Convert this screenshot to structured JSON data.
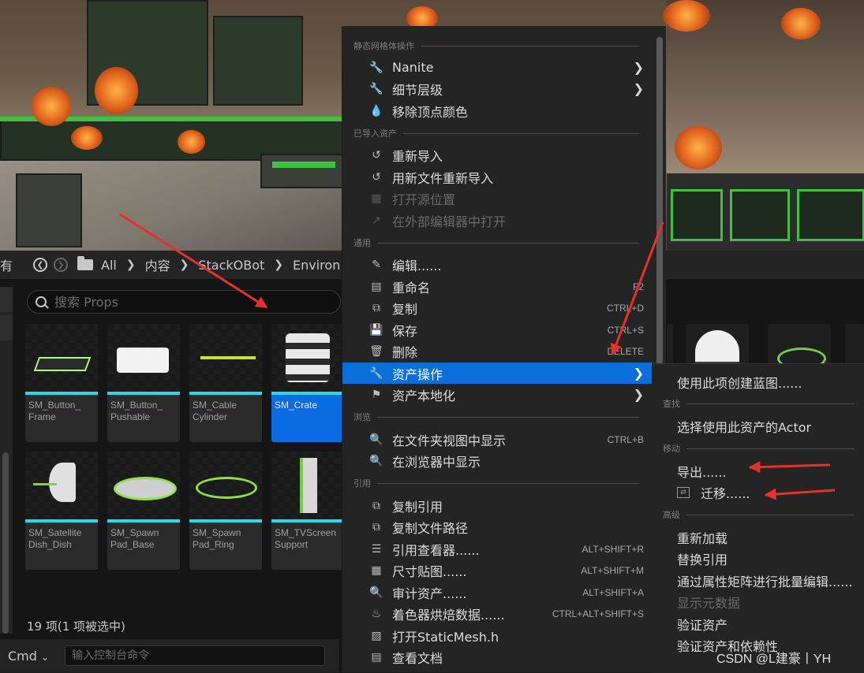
{
  "breadcrumb": {
    "leading": "有",
    "items": [
      "All",
      "内容",
      "StackOBot",
      "Environ"
    ]
  },
  "search": {
    "placeholder": "搜索 Props"
  },
  "assets": [
    {
      "label": "SM_Button_\nFrame",
      "selected": false
    },
    {
      "label": "SM_Button_\nPushable",
      "selected": false
    },
    {
      "label": "SM_Cable\nCylinder",
      "selected": false
    },
    {
      "label": "SM_Crate",
      "selected": true
    },
    {
      "label": "SM_Satellite\nDish_Dish",
      "selected": false
    },
    {
      "label": "SM_Spawn\nPad_Base",
      "selected": false
    },
    {
      "label": "SM_Spawn\nPad_Ring",
      "selected": false
    },
    {
      "label": "SM_TVScreen\nSupport",
      "selected": false
    }
  ],
  "status": {
    "count": "19 项(1 项被选中)"
  },
  "console": {
    "label": "Cmd",
    "placeholder": "输入控制台命令"
  },
  "menu": {
    "sections": {
      "static_mesh": "静态网格体操作",
      "imported": "已导入资产",
      "common": "通用",
      "browse": "浏览",
      "reference": "引用"
    },
    "items": {
      "nanite": {
        "label": "Nanite",
        "icon": "wrench-icon"
      },
      "lod": {
        "label": "细节层级",
        "icon": "wrench-icon"
      },
      "remove_vertex_color": {
        "label": "移除顶点颜色",
        "icon": "drop-icon"
      },
      "reimport": {
        "label": "重新导入",
        "icon": "reimport-icon"
      },
      "reimport_new": {
        "label": "用新文件重新导入",
        "icon": "reimport-icon"
      },
      "open_source": {
        "label": "打开源位置",
        "icon": "source-icon"
      },
      "open_external": {
        "label": "在外部编辑器中打开",
        "icon": "external-icon"
      },
      "edit": {
        "label": "编辑......",
        "icon": "pencil-icon"
      },
      "rename": {
        "label": "重命名",
        "icon": "rename-icon",
        "shortcut": "F2"
      },
      "duplicate": {
        "label": "复制",
        "icon": "duplicate-icon",
        "shortcut": "CTRL+D"
      },
      "save": {
        "label": "保存",
        "icon": "save-icon",
        "shortcut": "CTRL+S"
      },
      "delete": {
        "label": "删除",
        "icon": "trash-icon",
        "shortcut": "DELETE"
      },
      "asset_actions": {
        "label": "资产操作",
        "icon": "wrench-icon"
      },
      "localization": {
        "label": "资产本地化",
        "icon": "flag-icon"
      },
      "show_in_folder": {
        "label": "在文件夹视图中显示",
        "icon": "folder-search-icon",
        "shortcut": "CTRL+B"
      },
      "show_in_browser": {
        "label": "在浏览器中显示",
        "icon": "folder-search-icon"
      },
      "copy_reference": {
        "label": "复制引用",
        "icon": "copy-ref-icon"
      },
      "copy_path": {
        "label": "复制文件路径",
        "icon": "copy-ref-icon"
      },
      "ref_viewer": {
        "label": "引用查看器......",
        "icon": "graph-icon",
        "shortcut": "ALT+SHIFT+R"
      },
      "size_map": {
        "label": "尺寸贴图......",
        "icon": "sizemap-icon",
        "shortcut": "ALT+SHIFT+M"
      },
      "audit": {
        "label": "审计资产......",
        "icon": "audit-icon",
        "shortcut": "ALT+SHIFT+A"
      },
      "shader_data": {
        "label": "着色器烘焙数据......",
        "icon": "shader-icon",
        "shortcut": "CTRL+ALT+SHIFT+S"
      },
      "open_header": {
        "label": "打开StaticMesh.h",
        "icon": "cpp-icon"
      },
      "view_docs": {
        "label": "查看文档",
        "icon": "doc-icon"
      }
    }
  },
  "submenu": {
    "sections": {
      "find": "查找",
      "move": "移动",
      "advanced": "高级"
    },
    "items": {
      "create_blueprint": "使用此项创建蓝图......",
      "select_actors": "选择使用此资产的Actor",
      "export": "导出......",
      "migrate": "迁移......",
      "reload": "重新加载",
      "replace_refs": "替换引用",
      "bulk_edit": "通过属性矩阵进行批量编辑......",
      "show_metadata": "显示元数据",
      "validate": "验证资产",
      "validate_deps": "验证资产和依赖性"
    }
  },
  "watermark": "CSDN @L建豪丨YH",
  "colors": {
    "highlight": "#0a6fd8",
    "selected_tile": "#0b6be0",
    "accent_cyan": "#2cd9e8",
    "annotation": "#e8302a"
  }
}
